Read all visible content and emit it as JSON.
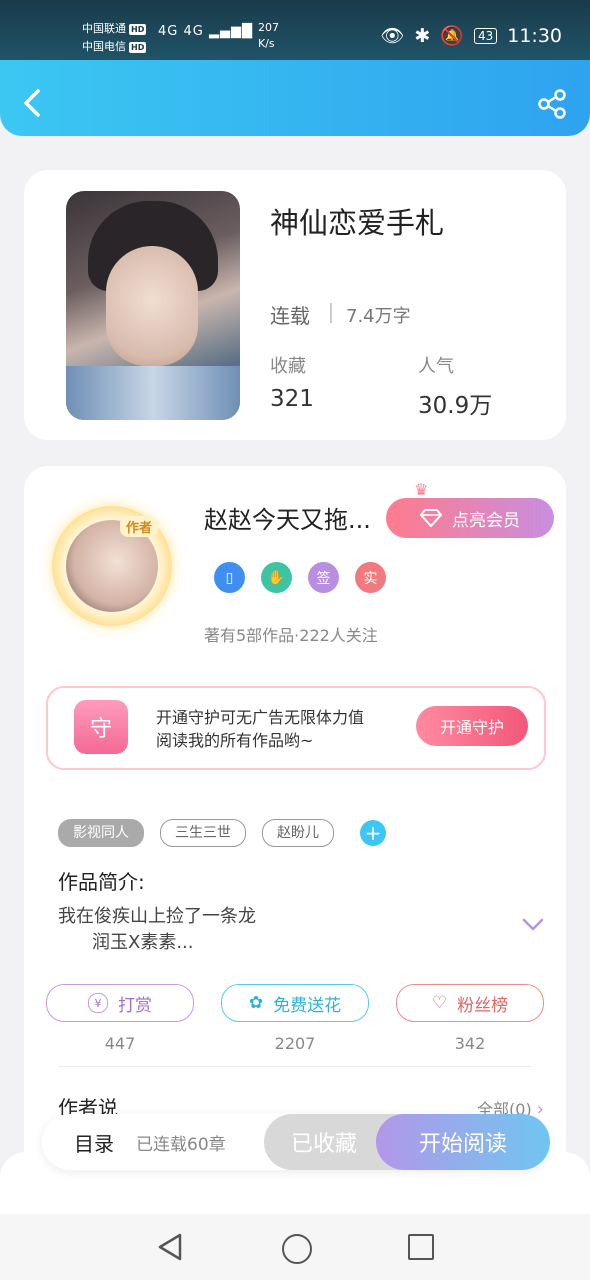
{
  "status_bar": {
    "carrier1": "中国联通",
    "carrier2": "中国电信",
    "hd_label": "HD",
    "signal": "4G 4G",
    "speed_value": "207",
    "speed_unit": "K/s",
    "battery": "43",
    "time": "11:30"
  },
  "book": {
    "title": "神仙恋爱手札",
    "status": "连载",
    "word_count": "7.4万字",
    "stats": [
      {
        "label": "收藏",
        "value": "321"
      },
      {
        "label": "人气",
        "value": "30.9万"
      }
    ]
  },
  "author": {
    "badge": "作者",
    "name": "赵赵今天又拖...",
    "vip_button": "点亮会员",
    "badges": [
      {
        "icon": "phone-badge-icon",
        "text": "",
        "color": "#3e8ff0"
      },
      {
        "icon": "handshake-badge-icon",
        "text": "",
        "color": "#3fc4a3"
      },
      {
        "icon": "signed-badge-icon",
        "text": "签",
        "color": "#b98ee0"
      },
      {
        "icon": "verified-badge-icon",
        "text": "实",
        "color": "#f07a80"
      }
    ],
    "meta": "著有5部作品·222人关注"
  },
  "guard": {
    "icon_text": "守",
    "line1": "开通守护可无广告无限体力值",
    "line2": "阅读我的所有作品哟~",
    "button": "开通守护"
  },
  "tags": [
    "影视同人",
    "三生三世",
    "赵盼儿"
  ],
  "intro": {
    "heading": "作品简介:",
    "line1": "我在俊疾山上捡了一条龙",
    "line2": "润玉X素素..."
  },
  "actions": [
    {
      "label": "打赏",
      "count": "447",
      "icon": "yen-icon"
    },
    {
      "label": "免费送花",
      "count": "2207",
      "icon": "flower-icon"
    },
    {
      "label": "粉丝榜",
      "count": "342",
      "icon": "fans-icon"
    }
  ],
  "author_says": {
    "heading": "作者说",
    "all_link": "全部(0)"
  },
  "bottom_bar": {
    "toc": "目录",
    "chapters": "已连载60章",
    "favorited": "已收藏",
    "start_reading": "开始阅读"
  }
}
